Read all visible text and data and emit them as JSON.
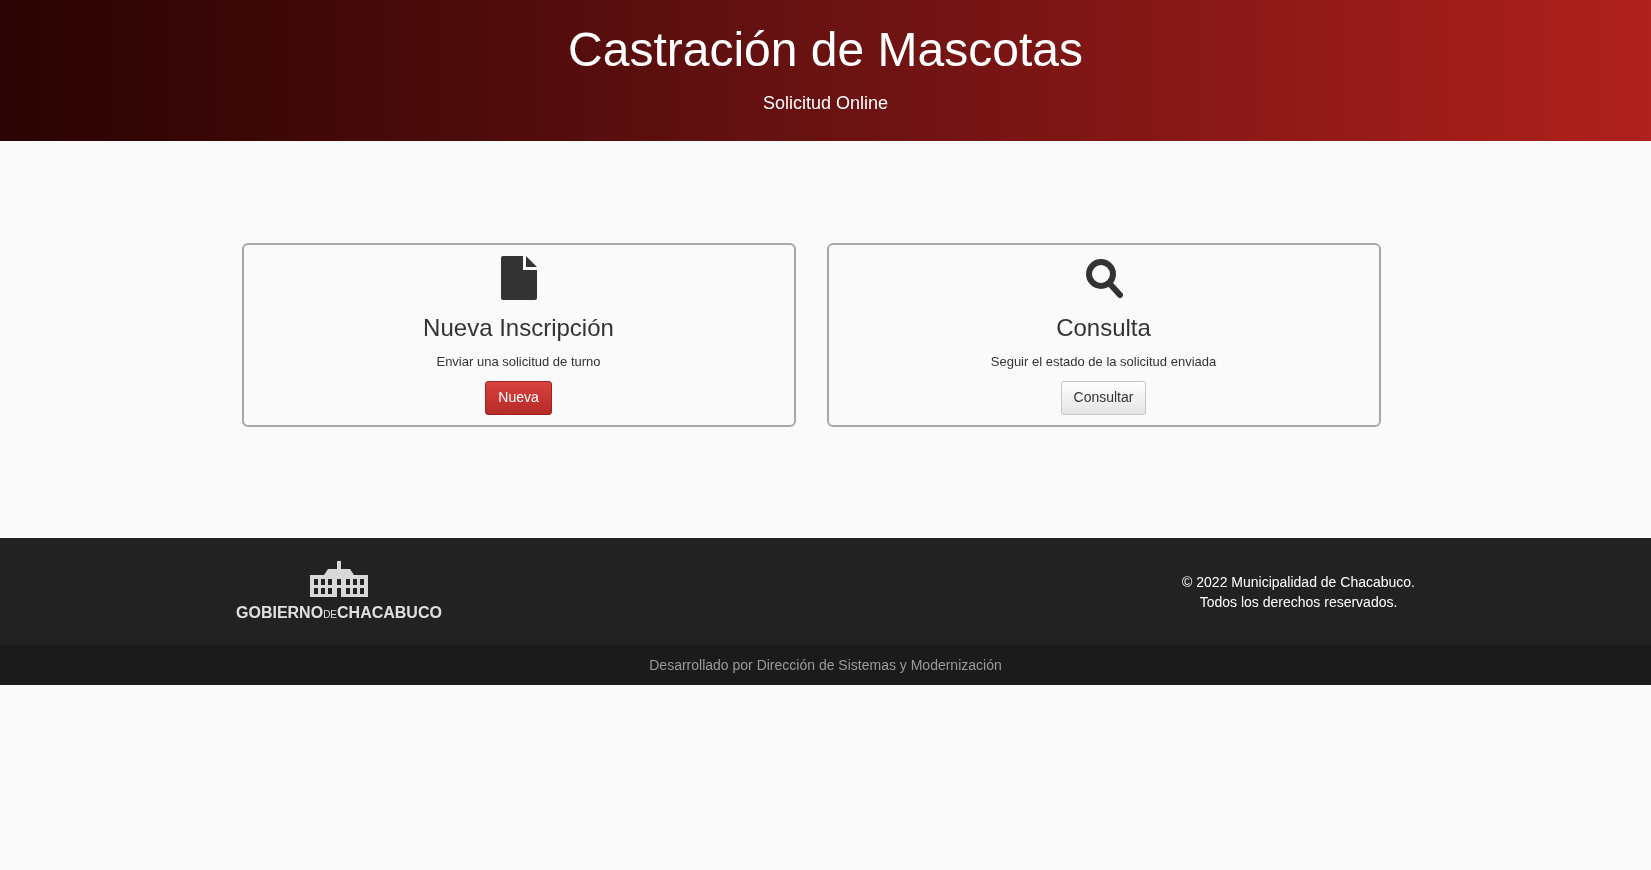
{
  "header": {
    "title": "Castración de Mascotas",
    "subtitle": "Solicitud Online"
  },
  "cards": [
    {
      "kind": "document",
      "title": "Nueva Inscripción",
      "description": "Enviar una solicitud de turno",
      "button": {
        "label": "Nueva",
        "kind": "primary"
      }
    },
    {
      "kind": "search",
      "title": "Consulta",
      "description": "Seguir el estado de la solicitud enviada",
      "button": {
        "label": "Consultar",
        "kind": "default"
      }
    }
  ],
  "footer": {
    "logo": {
      "words": [
        "GOBIERNO",
        "DE",
        "CHACABUCO"
      ]
    },
    "copyright": [
      "© 2022 Municipalidad de Chacabuco.",
      "Todos los derechos reservados."
    ],
    "credit": "Desarrollado por Dirección de Sistemas y Modernización"
  }
}
